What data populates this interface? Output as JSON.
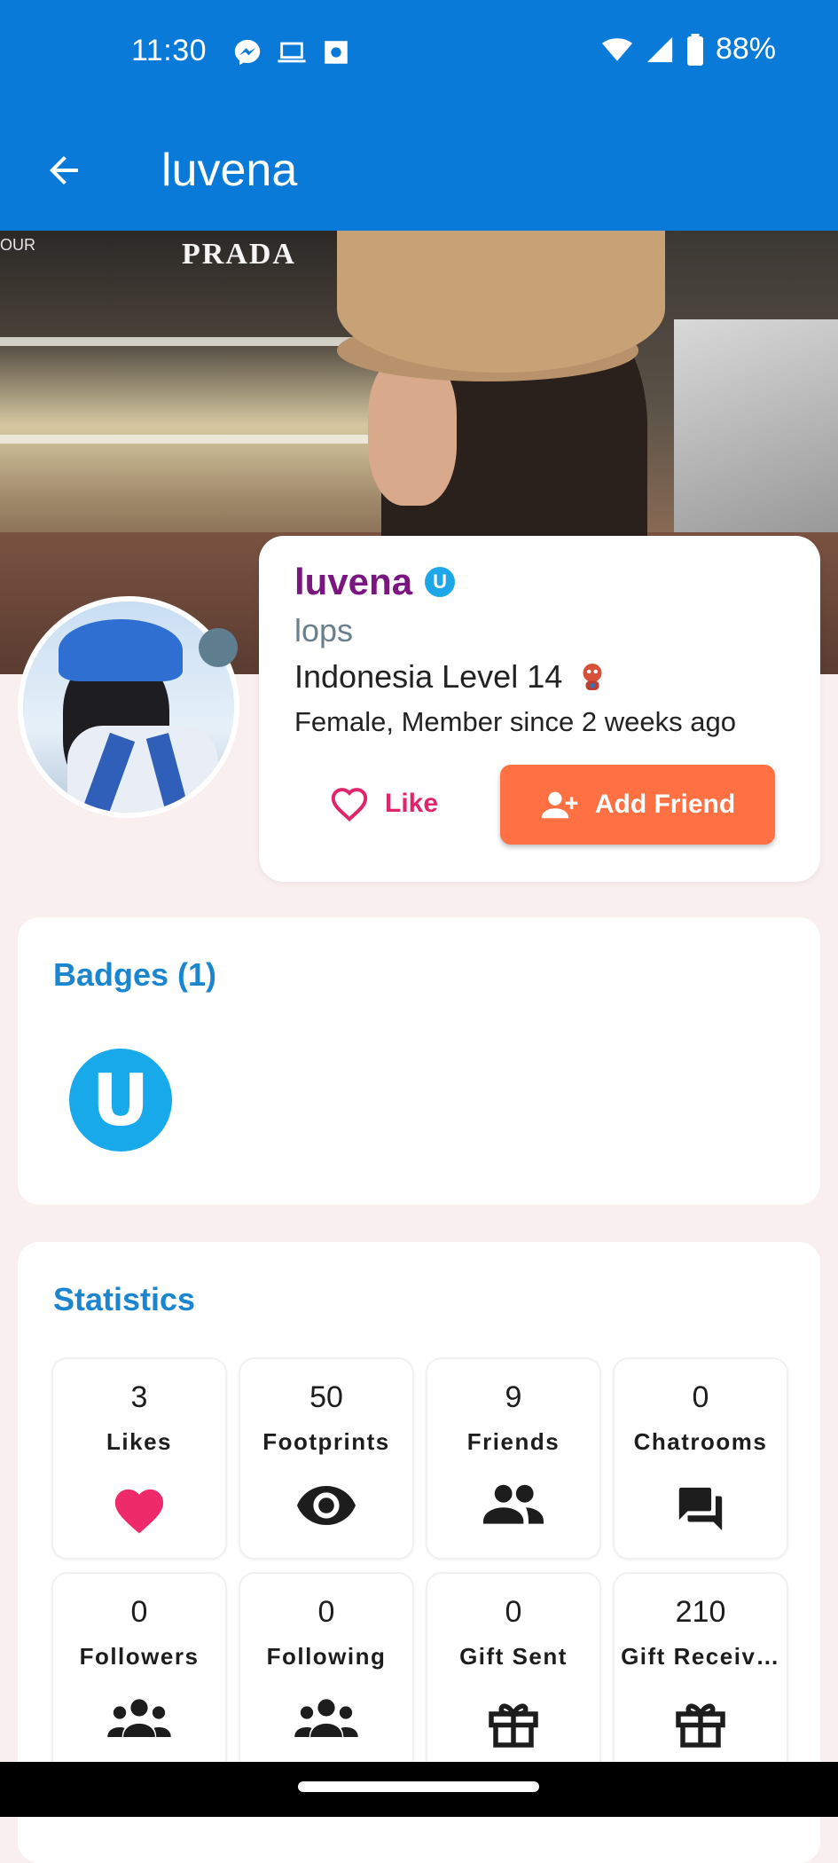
{
  "status_bar": {
    "time": "11:30",
    "battery": "88%"
  },
  "app_bar": {
    "title": "luvena"
  },
  "cover": {
    "sign_text": "PRADA",
    "sign_text_left": "OUR"
  },
  "profile": {
    "name": "luvena",
    "badge_letter": "U",
    "status": "lops",
    "country_level": "Indonesia Level  14",
    "meta": "Female, Member since 2 weeks ago",
    "like_label": "Like",
    "add_friend_label": "Add Friend"
  },
  "badges": {
    "title": "Badges (1)",
    "items": [
      {
        "letter": "U"
      }
    ]
  },
  "statistics": {
    "title": "Statistics",
    "items": [
      {
        "value": "3",
        "label": "Likes",
        "icon": "heart-icon"
      },
      {
        "value": "50",
        "label": "Footprints",
        "icon": "eye-icon"
      },
      {
        "value": "9",
        "label": "Friends",
        "icon": "people-icon"
      },
      {
        "value": "0",
        "label": "Chatrooms",
        "icon": "chat-icon"
      },
      {
        "value": "0",
        "label": "Followers",
        "icon": "groups-icon"
      },
      {
        "value": "0",
        "label": "Following",
        "icon": "groups-icon"
      },
      {
        "value": "0",
        "label": "Gift Sent",
        "icon": "gift-icon"
      },
      {
        "value": "210",
        "label": "Gift Receiv…",
        "icon": "gift-icon"
      }
    ]
  },
  "colors": {
    "app_bar": "#0a7ad8",
    "accent_orange": "#ff7043",
    "like_pink": "#e0256b",
    "name_purple": "#7b1580",
    "section_blue": "#1b86cf"
  }
}
